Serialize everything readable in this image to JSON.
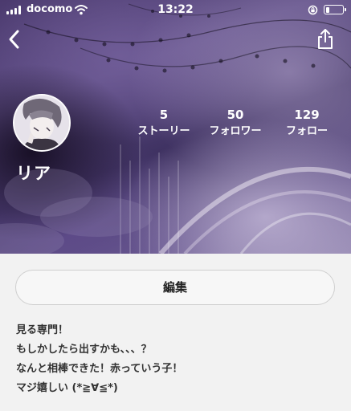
{
  "status_bar": {
    "carrier": "docomo",
    "time": "13:22",
    "signal_bars": 4,
    "battery_level_fraction": 0.2,
    "icons": [
      "signal-icon",
      "wifi-icon",
      "rotation-lock-icon",
      "battery-icon"
    ]
  },
  "nav": {
    "back_icon": "chevron-left-icon",
    "share_icon": "share-icon"
  },
  "profile": {
    "username": "リア",
    "stats": [
      {
        "value": "5",
        "label": "ストーリー"
      },
      {
        "value": "50",
        "label": "フォロワー"
      },
      {
        "value": "129",
        "label": "フォロー"
      }
    ]
  },
  "actions": {
    "edit_label": "編集"
  },
  "bio": {
    "lines": [
      "見る専門！",
      "もしかしたら出すかも、、、？",
      "なんと相棒できた！赤っていう子！",
      "マジ嬉しい (*≧∀≦*)"
    ]
  },
  "colors": {
    "cover_primary": "#4b3a6e",
    "page_background": "#f2f2f2",
    "text_light": "#ffffff",
    "text_dark": "#333333"
  }
}
